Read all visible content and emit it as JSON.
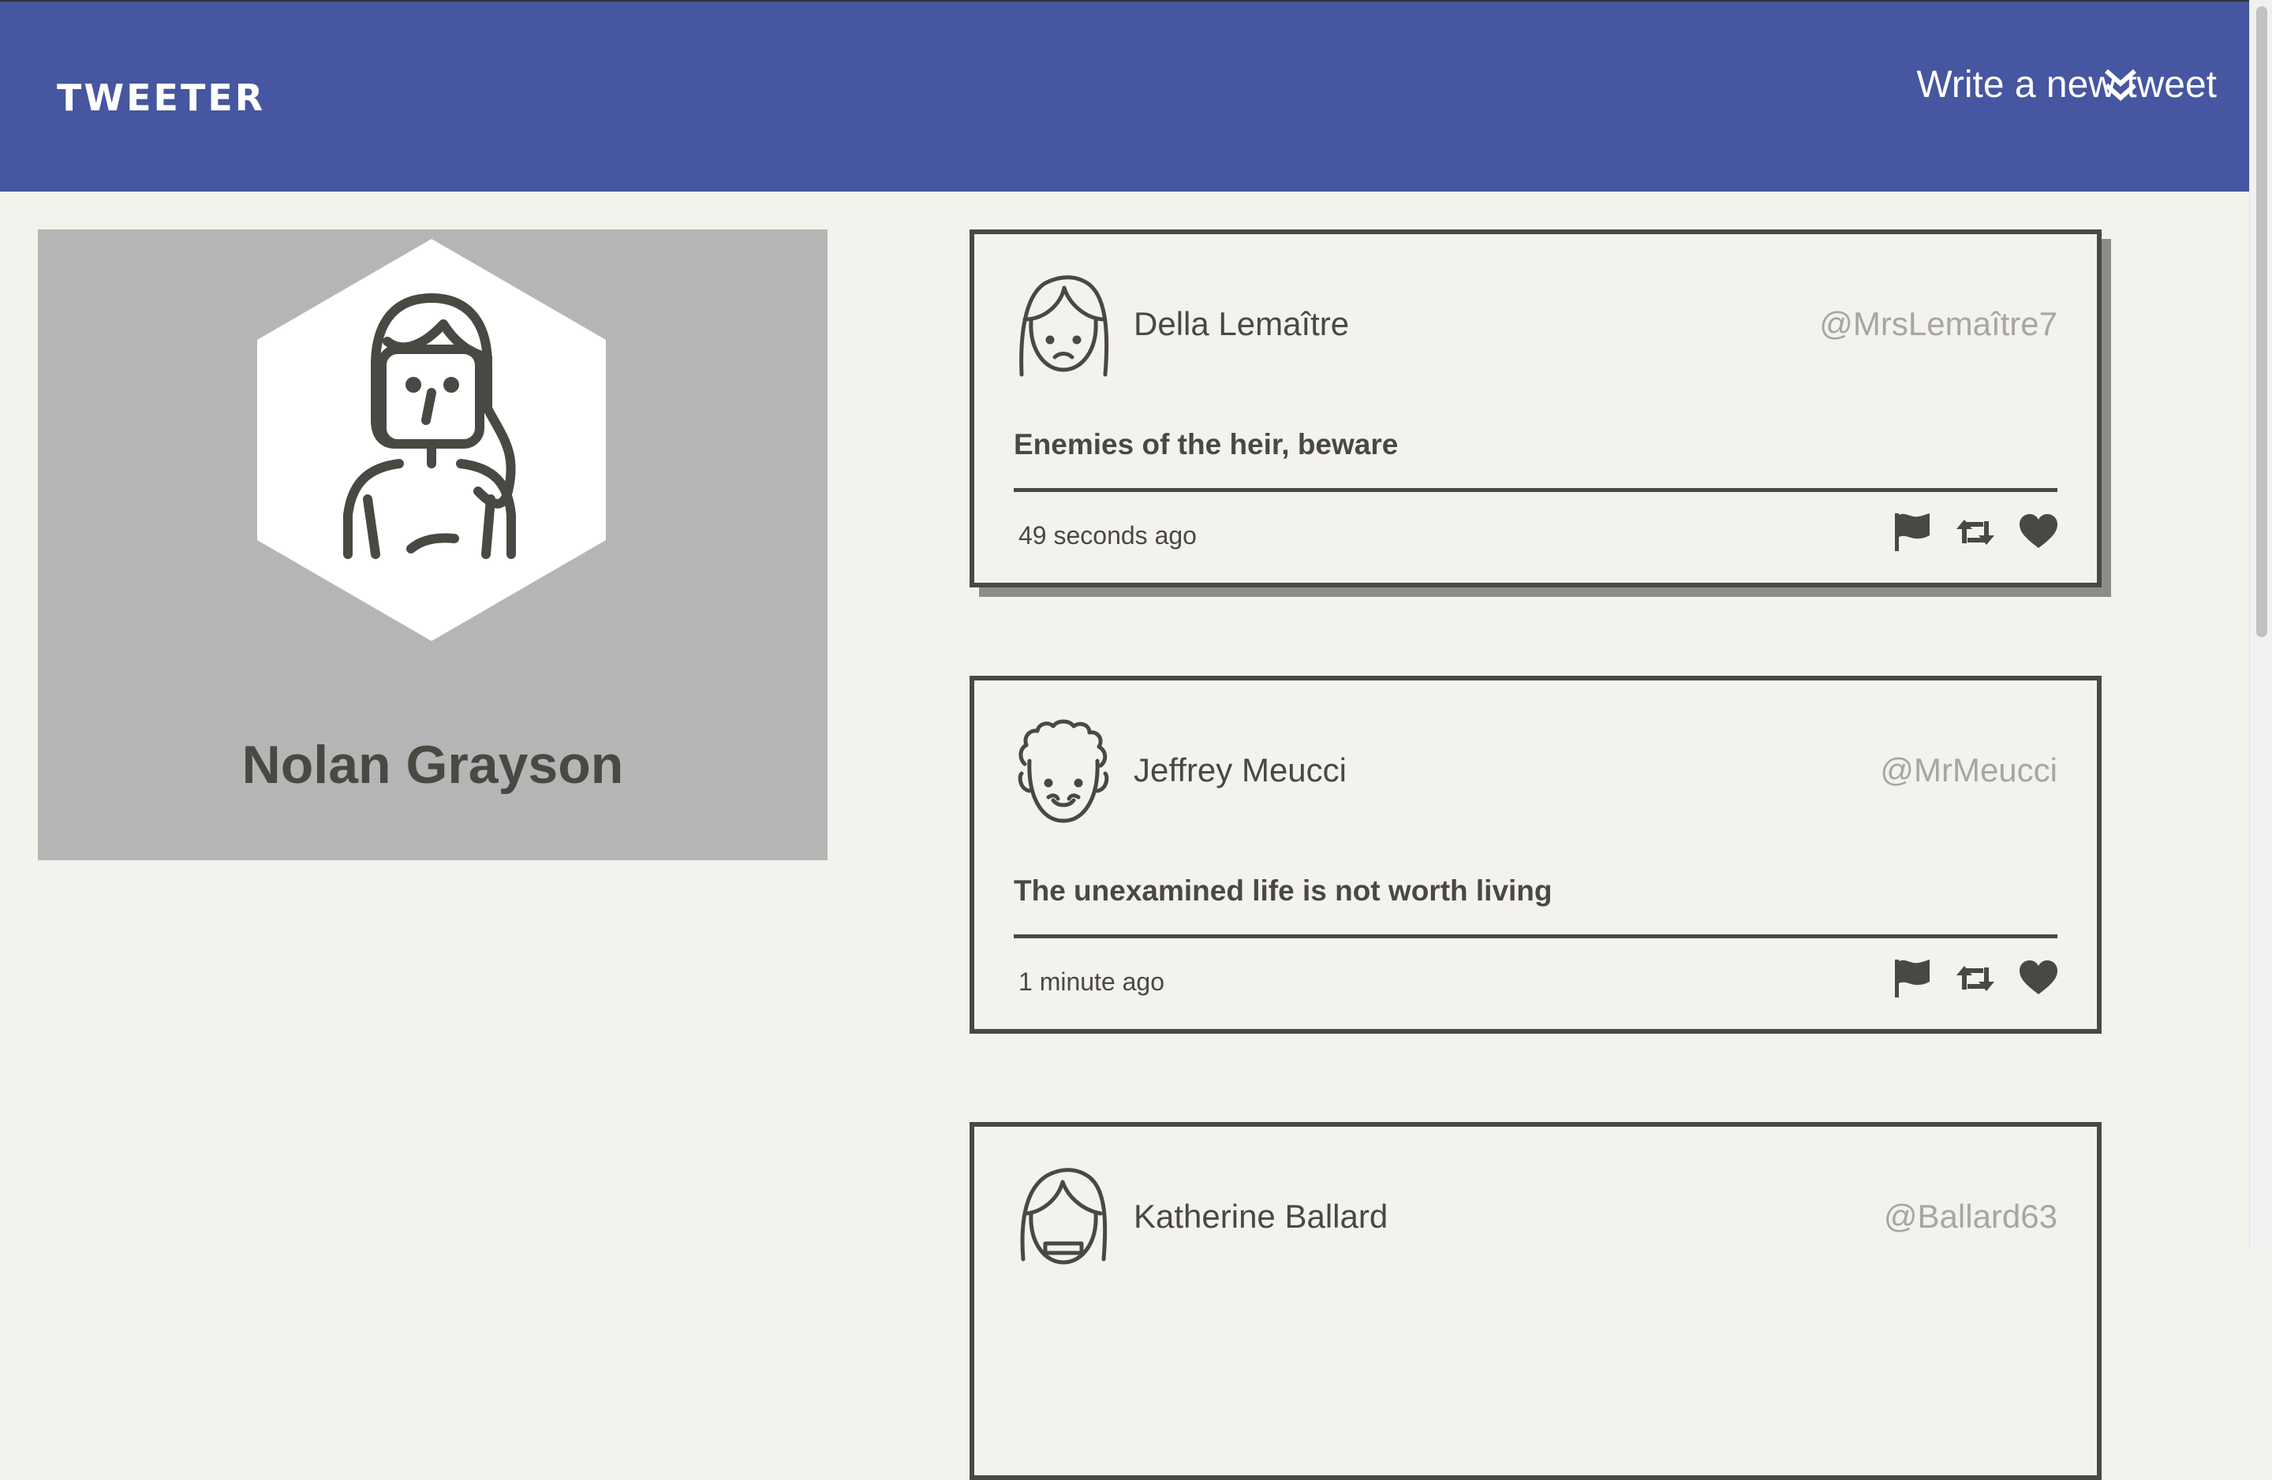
{
  "header": {
    "brand": "TWEETER",
    "compose_label": "Write a new tweet",
    "compose_icon": "double-chevron-down-icon"
  },
  "profile": {
    "name": "Nolan Grayson",
    "avatar_icon": "woman-avatar-icon"
  },
  "tweets": [
    {
      "author": "Della Lemaître",
      "handle": "@MrsLemaître7",
      "text": "Enemies of the heir, beware",
      "time": "49 seconds ago",
      "avatar_icon": "woman-avatar-icon"
    },
    {
      "author": "Jeffrey Meucci",
      "handle": "@MrMeucci",
      "text": "The unexamined life is not worth living",
      "time": "1 minute ago",
      "avatar_icon": "curly-hair-man-avatar-icon"
    },
    {
      "author": "Katherine Ballard",
      "handle": "@Ballard63",
      "text": "",
      "time": "",
      "avatar_icon": "woman-avatar-icon"
    }
  ],
  "actions": [
    "flag-icon",
    "retweet-icon",
    "heart-icon"
  ],
  "colors": {
    "nav": "#4656a0",
    "background": "#f4f2ed",
    "ink": "#4a4843",
    "handle": "#a8a6a2",
    "profile_card": "#b5b5b5"
  }
}
